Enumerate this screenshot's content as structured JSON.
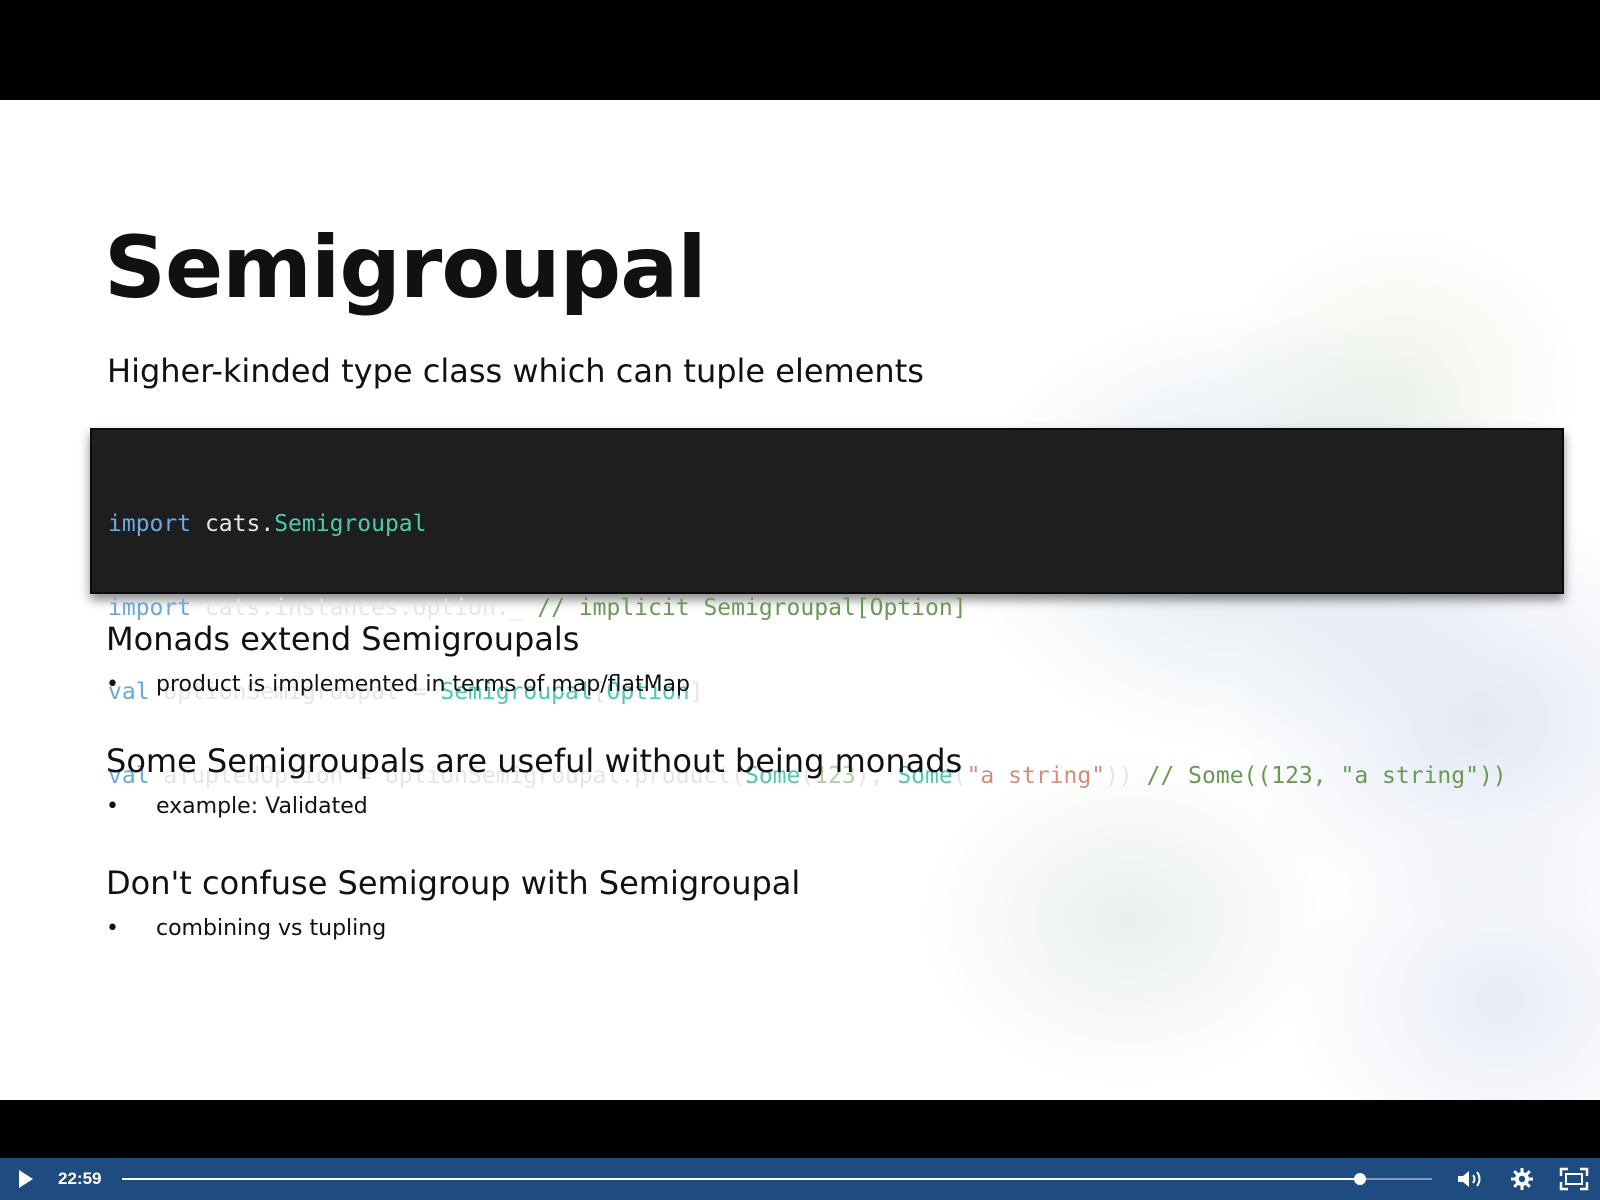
{
  "slide": {
    "title": "Semigroupal",
    "subtitle": "Higher-kinded type class which can tuple elements",
    "code_lines": [
      [
        {
          "t": "kw",
          "s": "import"
        },
        {
          "t": "tx",
          "s": " cats."
        },
        {
          "t": "ty",
          "s": "Semigroupal"
        }
      ],
      [
        {
          "t": "kw",
          "s": "import"
        },
        {
          "t": "tx",
          "s": " cats.instances.option._ "
        },
        {
          "t": "cm",
          "s": "// implicit Semigroupal[Option]"
        }
      ],
      [
        {
          "t": "kw",
          "s": "val"
        },
        {
          "t": "tx",
          "s": " optionSemigroupal = "
        },
        {
          "t": "ty",
          "s": "Semigroupal"
        },
        {
          "t": "tx",
          "s": "["
        },
        {
          "t": "ty",
          "s": "Option"
        },
        {
          "t": "tx",
          "s": "]"
        }
      ],
      [
        {
          "t": "kw",
          "s": "val"
        },
        {
          "t": "tx",
          "s": " aTupledOption = optionSemigroupal.product("
        },
        {
          "t": "ty",
          "s": "Some"
        },
        {
          "t": "tx",
          "s": "("
        },
        {
          "t": "nm",
          "s": "123"
        },
        {
          "t": "tx",
          "s": "), "
        },
        {
          "t": "ty",
          "s": "Some"
        },
        {
          "t": "tx",
          "s": "("
        },
        {
          "t": "st",
          "s": "\"a string\""
        },
        {
          "t": "tx",
          "s": ")) "
        },
        {
          "t": "cm",
          "s": "// Some((123, \"a string\"))"
        }
      ]
    ],
    "sections": [
      {
        "heading": "Monads extend Semigroupals",
        "bullet": "product is implemented in terms of map/flatMap"
      },
      {
        "heading": "Some Semigroupals are useful without being monads",
        "bullet": "example: Validated"
      },
      {
        "heading": "Don't confuse Semigroup with Semigroupal",
        "bullet": "combining vs tupling"
      }
    ],
    "bullet_symbol": "•"
  },
  "player": {
    "time": "22:59",
    "progress_fraction": 0.945,
    "bar_color": "#1e4b80",
    "icons": {
      "play": "play-icon",
      "volume": "volume-icon",
      "settings": "gear-icon",
      "fullscreen": "fullscreen-icon"
    }
  }
}
